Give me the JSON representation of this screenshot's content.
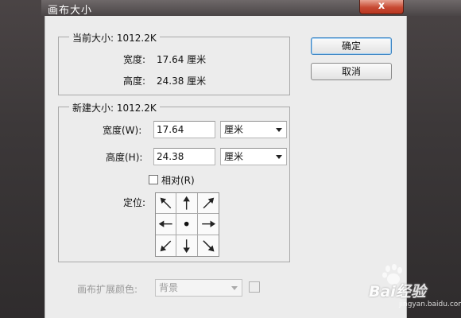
{
  "window": {
    "title": "画布大小",
    "close_glyph": "x"
  },
  "current_size": {
    "title": "当前大小: 1012.2K",
    "width_label": "宽度:",
    "width_value": "17.64 厘米",
    "height_label": "高度:",
    "height_value": "24.38 厘米"
  },
  "new_size": {
    "title": "新建大小: 1012.2K",
    "width_label": "宽度(W):",
    "width_value": "17.64",
    "width_unit": "厘米",
    "height_label": "高度(H):",
    "height_value": "24.38",
    "height_unit": "厘米",
    "relative_label": "相对(R)",
    "relative_checked": false,
    "anchor_label": "定位:",
    "anchor_selected": "center"
  },
  "buttons": {
    "ok": "确定",
    "cancel": "取消"
  },
  "extension_color": {
    "label": "画布扩展颜色:",
    "value": "背景"
  },
  "watermark": {
    "text": "Bai经验",
    "sub": "jingyan.baidu.com"
  },
  "colors": {
    "dialog_bg": "#ececec",
    "frame_dark": "#3c3839",
    "close_red": "#c74a33",
    "default_button_border": "#3b84c4"
  }
}
